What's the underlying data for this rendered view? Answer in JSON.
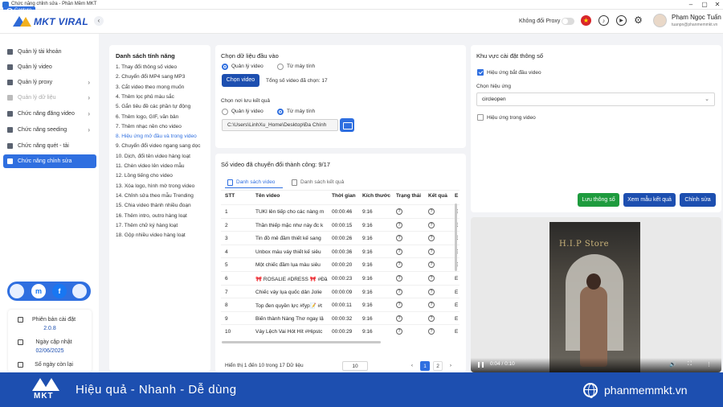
{
  "window": {
    "title": "Chức năng chỉnh sửa - Phần Mềm MKT",
    "capture_label": "Capture",
    "minimize": "–",
    "maximize": "▢",
    "close": "✕"
  },
  "brand": {
    "logo_text": "MKT VIRAL",
    "collapse": "‹"
  },
  "header": {
    "proxy_label": "Không đổi Proxy",
    "flag": "★",
    "bell": "♪",
    "play": "▶",
    "gear": "⚙",
    "user_name": "Phạm Ngọc Tuấn",
    "user_email": "tuanpn@phanmemmkt.vn"
  },
  "sidebar": {
    "items": [
      {
        "label": "Quản lý tài khoản",
        "chevron": ""
      },
      {
        "label": "Quản lý video",
        "chevron": ""
      },
      {
        "label": "Quản lý proxy",
        "chevron": "›"
      },
      {
        "label": "Quản lý dữ liệu",
        "chevron": "›"
      },
      {
        "label": "Chức năng đăng video",
        "chevron": "›"
      },
      {
        "label": "Chức năng seeding",
        "chevron": "›"
      },
      {
        "label": "Chức năng quét - tải",
        "chevron": ""
      },
      {
        "label": "Chức năng chỉnh sửa",
        "chevron": ""
      }
    ],
    "social": {
      "messenger": "m",
      "facebook": "f"
    },
    "info": {
      "version_label": "Phiên bản cài đặt",
      "version": "2.0.8",
      "update_label": "Ngày cập nhật",
      "update_date": "02/06/2025",
      "days_label": "Số ngày còn lại"
    }
  },
  "features": {
    "title": "Danh sách tính năng",
    "items": [
      "1. Thay đổi thông số video",
      "2. Chuyển đổi MP4 sang MP3",
      "3. Cắt video theo mong muốn",
      "4. Thêm lọc phủ màu sắc",
      "5. Gắn tiêu đề các phần tự động",
      "6. Thêm logo, GIF, văn bản",
      "7. Thêm nhạc nền cho video",
      "8. Hiệu ứng mở đầu và trong video",
      "9. Chuyển đổi video ngang sang dọc",
      "10. Dịch, đổi tên video hàng loạt",
      "11. Chèn video lên video mẫu",
      "12. Lồng tiếng cho video",
      "13. Xóa logo, hình mờ trong video",
      "14. Chỉnh sửa theo mẫu Trending",
      "15. Chia video thành nhiều đoạn",
      "16. Thêm intro, outro hàng loạt",
      "17. Thêm chữ ký hàng loạt",
      "18. Gộp nhiều video hàng loạt"
    ]
  },
  "input": {
    "title": "Chọn dữ liệu đầu vào",
    "opt_manage": "Quản lý video",
    "opt_local": "Từ máy tính",
    "choose_btn": "Chọn video",
    "total_label": "Tổng số video đã chọn: 17",
    "output_label": "Chọn nơi lưu kết quả",
    "out_manage": "Quản lý video",
    "out_local": "Từ máy tính",
    "path": "C:\\Users\\LinhXu_Home\\Desktop\\Đa Chính"
  },
  "list": {
    "title": "Số video đã chuyển đổi thành công: 9/17",
    "tab_videos": "Danh sách video",
    "tab_results": "Danh sách kết quả",
    "columns": [
      "STT",
      "Tên video",
      "Thời gian",
      "Kích thước",
      "Trạng thái",
      "Kết quả",
      "E"
    ],
    "rows": [
      [
        "1",
        "TUKI lên tiếp cho các nàng m",
        "00:00:46",
        "9:16",
        "?",
        "?",
        "E"
      ],
      [
        "2",
        "Thần thiếp mặc như này đc k",
        "00:00:15",
        "9:16",
        "?",
        "?",
        "E"
      ],
      [
        "3",
        "Tin đồ mê đầm thiết kế sang",
        "00:00:26",
        "9:16",
        "?",
        "?",
        "E"
      ],
      [
        "4",
        "Unbox mẫu váy thiết kế siêu",
        "00:00:36",
        "9:16",
        "?",
        "?",
        "E"
      ],
      [
        "5",
        "Một chiếc đầm lụa màu siêu",
        "00:00:20",
        "9:16",
        "?",
        "?",
        "E"
      ],
      [
        "6",
        "🎀 ROSALIE #DRESS 🎀 #Đầ",
        "00:00:23",
        "9:16",
        "?",
        "?",
        "E"
      ],
      [
        "7",
        "Chiếc váy lụa quốc dân Jolie",
        "00:00:09",
        "9:16",
        "?",
        "?",
        "E"
      ],
      [
        "8",
        "Top đen quyền lực #fyp📝 #t",
        "00:00:11",
        "9:16",
        "?",
        "?",
        "E"
      ],
      [
        "9",
        "Biến thành Nàng Thơ ngay lậ",
        "00:00:32",
        "9:16",
        "?",
        "?",
        "E"
      ],
      [
        "10",
        "Váy Lệch Vai Hót Hít #Hipstc",
        "00:00:29",
        "9:16",
        "?",
        "?",
        "E"
      ]
    ],
    "footer": "Hiển thị 1 đến 10 trong 17 Dữ liệu",
    "page_size": "10",
    "prev": "‹",
    "page1": "1",
    "page2": "2",
    "next": "›"
  },
  "settings": {
    "title": "Khu vực cài đặt thông số",
    "start_effect_label": "Hiệu ứng bắt đầu video",
    "start_effect_checked": true,
    "effect_select_label": "Chọn hiệu ứng",
    "effect_value": "circleopen",
    "in_video_label": "Hiệu ứng trong video",
    "in_video_checked": false,
    "save_btn": "Lưu thông số",
    "view_btn": "Xem mẫu kết quả",
    "edit_btn": "Chỉnh sửa"
  },
  "player": {
    "sign_text": "H.I.P Store",
    "time": "0:04 / 0:10",
    "volume": "🔊",
    "fullscreen": "⛶",
    "more": "⋮"
  },
  "banner": {
    "brand": "MKT",
    "slogan": "Hiệu quả - Nhanh - Dễ dùng",
    "site": "phanmemmkt.vn"
  },
  "colors": {
    "primary": "#2f6fe0",
    "dark_primary": "#1d4fb0",
    "success": "#1e9b3e"
  }
}
